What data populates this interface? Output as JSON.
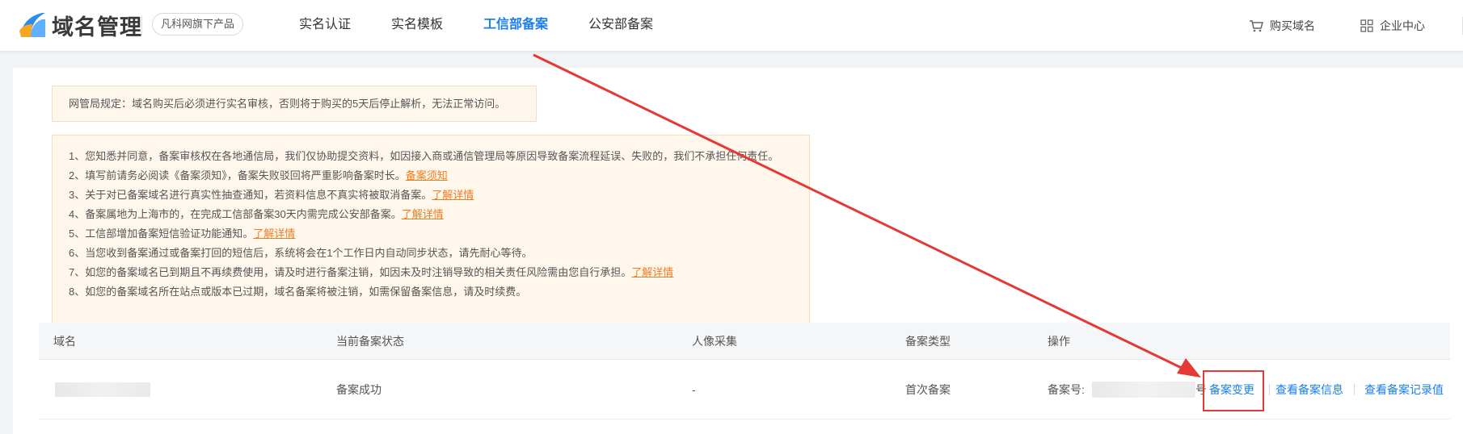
{
  "header": {
    "brand": "域名管理",
    "badge": "凡科网旗下产品",
    "nav": [
      {
        "label": "实名认证",
        "active": false
      },
      {
        "label": "实名模板",
        "active": false
      },
      {
        "label": "工信部备案",
        "active": true
      },
      {
        "label": "公安部备案",
        "active": false
      }
    ],
    "buy_domain": "购买域名",
    "enterprise": "企业中心"
  },
  "notice": "网管局规定：域名购买后必须进行实名审核，否则将于购买的5天后停止解析，无法正常访问。",
  "rules": [
    {
      "text": "1、您知悉并同意，备案审核权在各地通信局，我们仅协助提交资料，如因接入商或通信管理局等原因导致备案流程延误、失败的，我们不承担任何责任。",
      "link": ""
    },
    {
      "text": "2、填写前请务必阅读《备案须知》，备案失败驳回将严重影响备案时长。",
      "link": "备案须知"
    },
    {
      "text": "3、关于对已备案域名进行真实性抽查通知，若资料信息不真实将被取消备案。",
      "link": "了解详情"
    },
    {
      "text": "4、备案属地为上海市的，在完成工信部备案30天内需完成公安部备案。",
      "link": "了解详情"
    },
    {
      "text": "5、工信部增加备案短信验证功能通知。",
      "link": "了解详情"
    },
    {
      "text": "6、当您收到备案通过或备案打回的短信后，系统将会在1个工作日内自动同步状态，请先耐心等待。",
      "link": ""
    },
    {
      "text": "7、如您的备案域名已到期且不再续费使用，请及时进行备案注销，如因未及时注销导致的相关责任风险需由您自行承担。",
      "link": "了解详情"
    },
    {
      "text": "8、如您的备案域名所在站点或版本已过期，域名备案将被注销，如需保留备案信息，请及时续费。",
      "link": ""
    }
  ],
  "table": {
    "headers": [
      "域名",
      "当前备案状态",
      "人像采集",
      "备案类型",
      "操作"
    ],
    "row": {
      "status": "备案成功",
      "face": "-",
      "type": "首次备案",
      "record_label": "备案号:",
      "record_tail": "号",
      "actions": [
        "备案变更",
        "查看备案信息",
        "查看备案记录值"
      ]
    }
  },
  "colors": {
    "accent": "#1a7ef2",
    "link_orange": "#f07b20",
    "highlight_red": "#e53935"
  }
}
